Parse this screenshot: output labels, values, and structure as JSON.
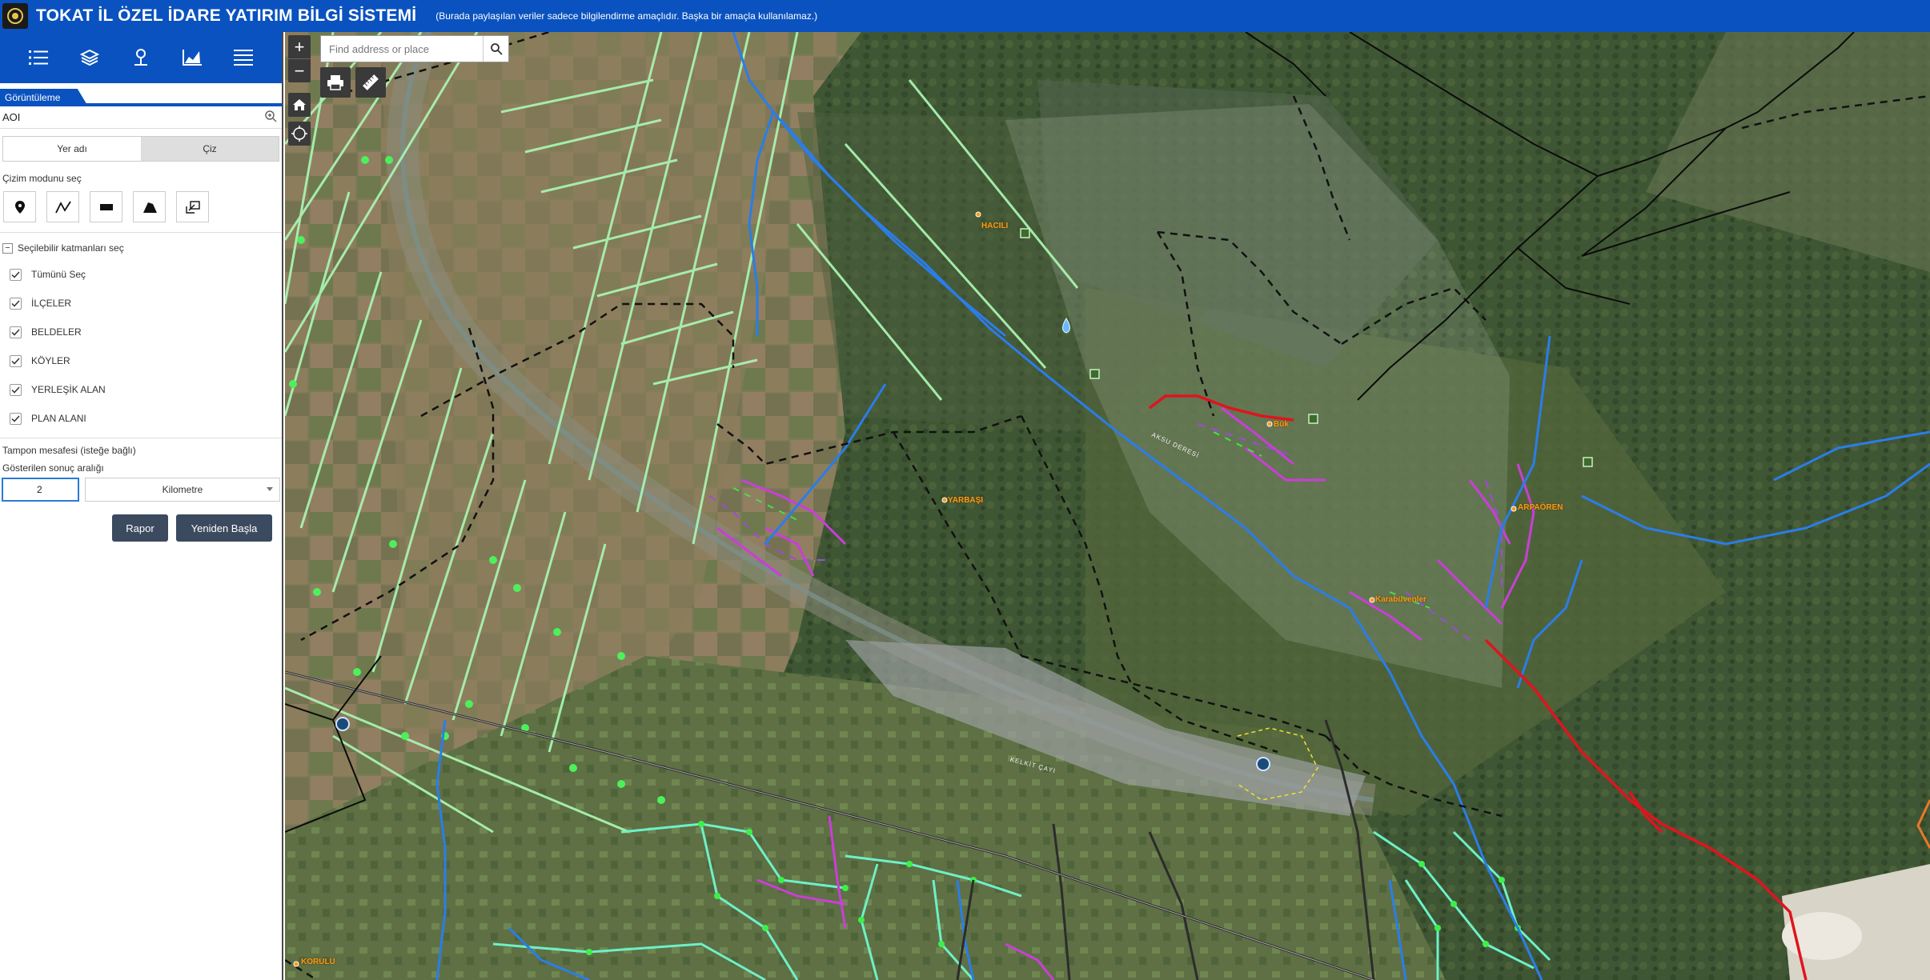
{
  "header": {
    "title": "TOKAT İL ÖZEL İDARE YATIRIM BİLGİ SİSTEMİ",
    "subtitle": "(Burada paylaşılan veriler sadece bilgilendirme amaçlıdır. Başka bir amaçla kullanılamaz.)"
  },
  "sidebar": {
    "toolbar_icons": [
      "list-icon",
      "layers-icon",
      "pin-icon",
      "chart-icon",
      "menu-icon"
    ],
    "tab_label": "Görüntüleme",
    "aoi_label": "AOI",
    "segment": {
      "left": "Yer adı",
      "right": "Çiz",
      "active": "right"
    },
    "draw_mode_label": "Çizim modunu seç",
    "draw_tools": [
      "point-tool-icon",
      "polyline-tool-icon",
      "rectangle-tool-icon",
      "polygon-tool-icon",
      "extent-tool-icon"
    ],
    "layers_header": "Seçilebilir katmanları seç",
    "layers": [
      {
        "label": "Tümünü Seç",
        "checked": true
      },
      {
        "label": "İLÇELER",
        "checked": true
      },
      {
        "label": "BELDELER",
        "checked": true
      },
      {
        "label": "KÖYLER",
        "checked": true
      },
      {
        "label": "YERLEŞİK ALAN",
        "checked": true
      },
      {
        "label": "PLAN ALANI",
        "checked": true
      }
    ],
    "buffer_label": "Tampon mesafesi (isteğe bağlı)",
    "result_label": "Gösterilen sonuç aralığı",
    "buffer_value": "2",
    "buffer_unit": "Kilometre",
    "report_button": "Rapor",
    "restart_button": "Yeniden Başla"
  },
  "map": {
    "search_placeholder": "Find address or place",
    "zoom_in": "+",
    "zoom_out": "−",
    "places": [
      {
        "name": "HACILI"
      },
      {
        "name": "Bük"
      },
      {
        "name": "YARBAŞI"
      },
      {
        "name": "ARPAÖREN"
      },
      {
        "name": "Karabüvenler"
      },
      {
        "name": "KORULU"
      }
    ],
    "roads": [
      "AKSU DERESİ",
      "KELKİT ÇAYI"
    ],
    "colors": {
      "header": "#0a52bf",
      "river": "#2a7ae0",
      "road_red": "#e0141e",
      "parcel_green": "#9ff0a0",
      "boundary": "#111111"
    }
  }
}
